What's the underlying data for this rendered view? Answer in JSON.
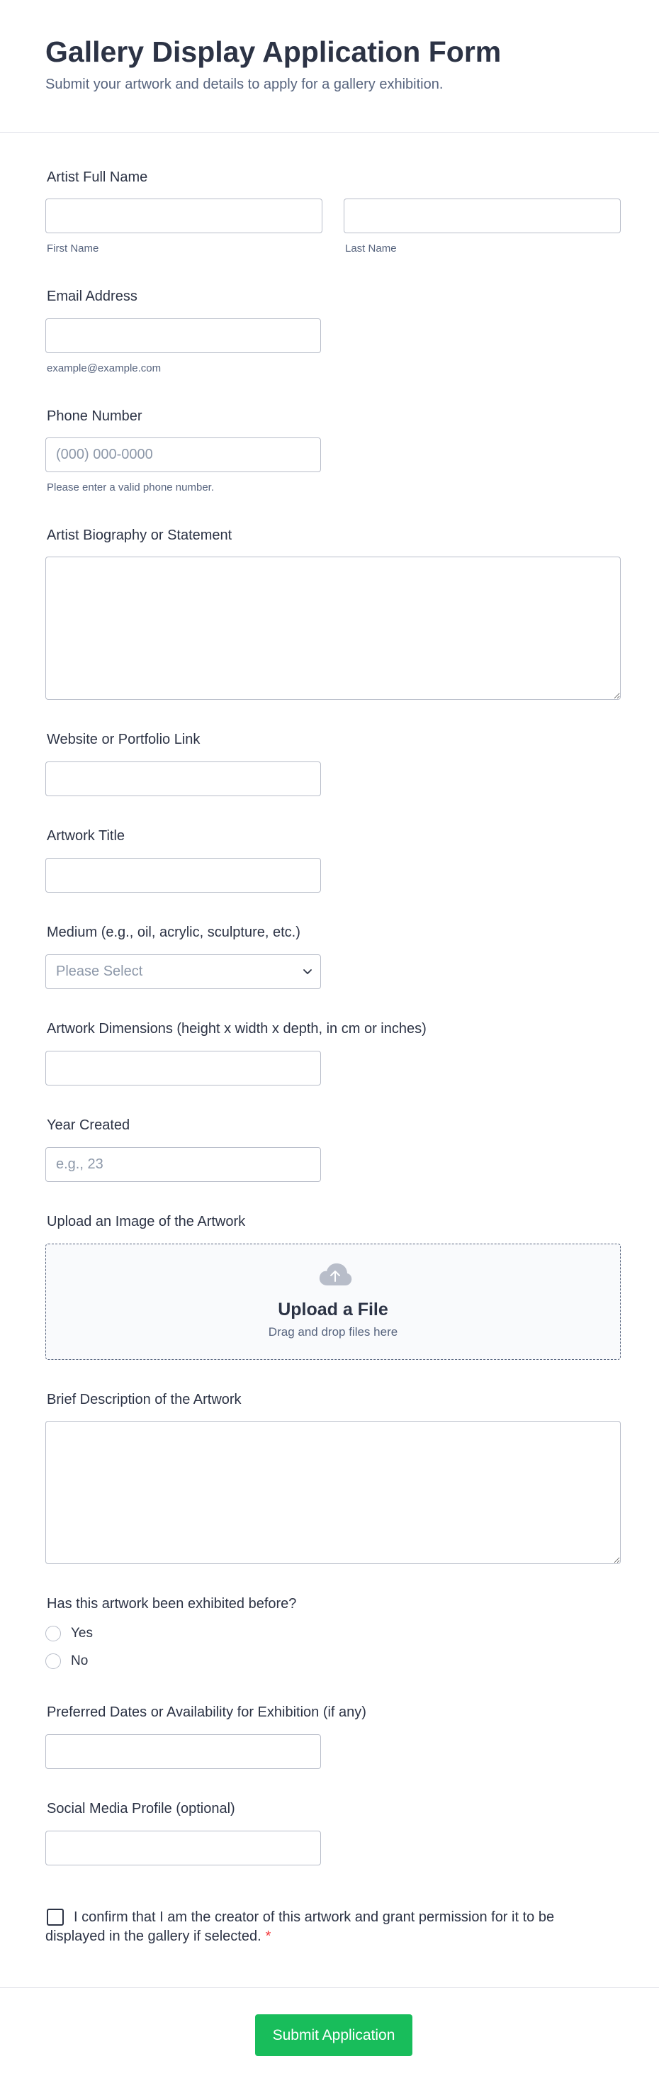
{
  "header": {
    "title": "Gallery Display Application Form",
    "subtitle": "Submit your artwork and details to apply for a gallery exhibition."
  },
  "fields": {
    "artist_name": {
      "label": "Artist Full Name",
      "first_sublabel": "First Name",
      "last_sublabel": "Last Name",
      "first_value": "",
      "last_value": ""
    },
    "email": {
      "label": "Email Address",
      "sublabel": "example@example.com",
      "value": ""
    },
    "phone": {
      "label": "Phone Number",
      "placeholder": "(000) 000-0000",
      "sublabel": "Please enter a valid phone number."
    },
    "biography": {
      "label": "Artist Biography or Statement"
    },
    "website": {
      "label": "Website or Portfolio Link"
    },
    "artwork_title": {
      "label": "Artwork Title"
    },
    "medium": {
      "label": "Medium (e.g., oil, acrylic, sculpture, etc.)",
      "selected": "Please Select"
    },
    "dimensions": {
      "label": "Artwork Dimensions (height x width x depth, in cm or inches)"
    },
    "year": {
      "label": "Year Created",
      "placeholder": "e.g., 23"
    },
    "upload": {
      "label": "Upload an Image of the Artwork",
      "title": "Upload a File",
      "hint": "Drag and drop files here"
    },
    "description": {
      "label": "Brief Description of the Artwork"
    },
    "exhibited": {
      "label": "Has this artwork been exhibited before?",
      "options": [
        "Yes",
        "No"
      ]
    },
    "dates": {
      "label": "Preferred Dates or Availability for Exhibition (if any)"
    },
    "social": {
      "label": "Social Media Profile (optional)"
    },
    "consent": {
      "text": "I confirm that I am the creator of this artwork and grant permission for it to be displayed in the gallery if selected.",
      "required_mark": "*"
    }
  },
  "submit": {
    "label": "Submit Application"
  },
  "colors": {
    "accent": "#18bd5b",
    "text": "#2c3345",
    "muted": "#57647e",
    "border": "#b8bdc9",
    "required": "#f23a3c"
  },
  "icons": {
    "upload": "cloud-upload-icon",
    "select": "chevron-down-icon"
  }
}
